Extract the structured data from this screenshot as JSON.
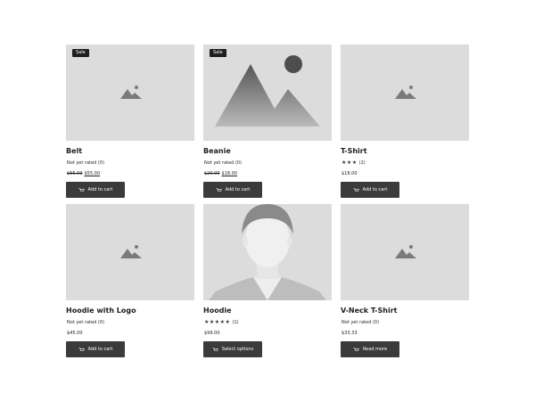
{
  "products": [
    {
      "title": "Belt",
      "badge": "Sale",
      "rating": "Not yet rated",
      "reviews": "(0)",
      "old_price": "$65.00",
      "price": "$55.00",
      "button": "Add to cart",
      "stars": ""
    },
    {
      "title": "Beanie",
      "badge": "Sale",
      "rating": "Not yet rated",
      "reviews": "(0)",
      "old_price": "$20.00",
      "price": "$18.00",
      "button": "Add to cart",
      "stars": ""
    },
    {
      "title": "T-Shirt",
      "badge": "",
      "rating": "",
      "reviews": "(2)",
      "old_price": "",
      "price": "$18.00",
      "button": "Add to cart",
      "stars": "★★★"
    },
    {
      "title": "Hoodie with Logo",
      "badge": "",
      "rating": "Not yet rated",
      "reviews": "(0)",
      "old_price": "",
      "price": "$45.00",
      "button": "Add to cart",
      "stars": ""
    },
    {
      "title": "Hoodie",
      "badge": "",
      "rating": "",
      "reviews": "(1)",
      "old_price": "",
      "price": "$99.00",
      "button": "Select options",
      "stars": "★★★★★"
    },
    {
      "title": "V-Neck T-Shirt",
      "badge": "",
      "rating": "Not yet rated",
      "reviews": "(0)",
      "old_price": "",
      "price": "$33.33",
      "button": "Read more",
      "stars": ""
    }
  ],
  "icons": {
    "image_placeholder": "image-placeholder-icon",
    "cart": "cart-icon",
    "star": "star-icon"
  },
  "colors": {
    "button_bg": "#3b3b3b",
    "placeholder_bg": "#dcdcdc",
    "badge_bg": "#1e1e1e"
  }
}
